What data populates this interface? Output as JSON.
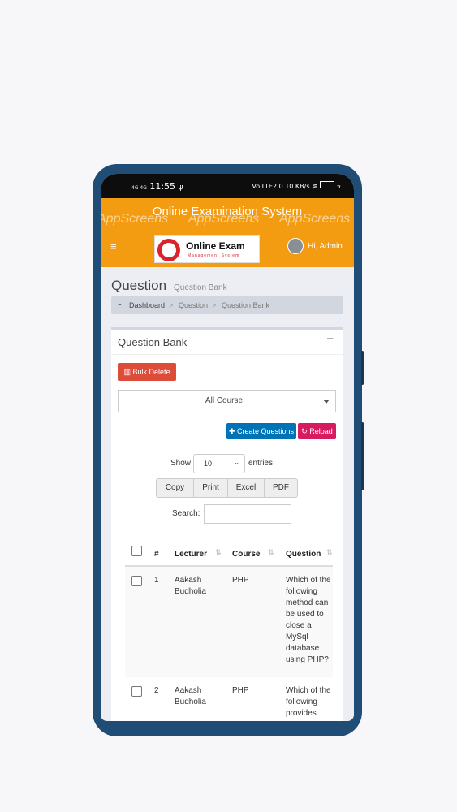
{
  "status_bar": {
    "time": "11:55",
    "left_icons": "4G 4G",
    "right_icons": "Vo LTE2 0.10 KB/s"
  },
  "app": {
    "title": "Online Examination System",
    "watermark": "AppScreens"
  },
  "header": {
    "menu_icon": "hamburger-icon",
    "logo_title": "Online Exam",
    "logo_subtitle": "Management System",
    "user_greeting": "Hi, Admin"
  },
  "page": {
    "title": "Question",
    "subtitle": "Question Bank"
  },
  "breadcrumb": {
    "items": [
      "Dashboard",
      "Question",
      "Question Bank"
    ],
    "separator": ">"
  },
  "box": {
    "title": "Question Bank",
    "collapse_icon": "−",
    "bulk_delete": "Bulk Delete",
    "course_select": "All Course",
    "create_button": "Create Questions",
    "reload_button": "Reload"
  },
  "datatable": {
    "show_label": "Show",
    "length_value": "10",
    "entries_label": "entries",
    "buttons": [
      "Copy",
      "Print",
      "Excel",
      "PDF"
    ],
    "search_label": "Search:",
    "columns": [
      "#",
      "Lecturer",
      "Course",
      "Question"
    ],
    "rows": [
      {
        "num": "1",
        "lecturer": "Aakash Budholia",
        "course": "PHP",
        "question": "Which of the following method can be used to close a MySql database using PHP?"
      },
      {
        "num": "2",
        "lecturer": "Aakash Budholia",
        "course": "PHP",
        "question": "Which of the following provides content type"
      }
    ]
  },
  "colors": {
    "phone": "#1f4d76",
    "header": "#f39c12",
    "danger": "#dd4b39",
    "primary": "#0073b7",
    "pink": "#d81b60"
  }
}
